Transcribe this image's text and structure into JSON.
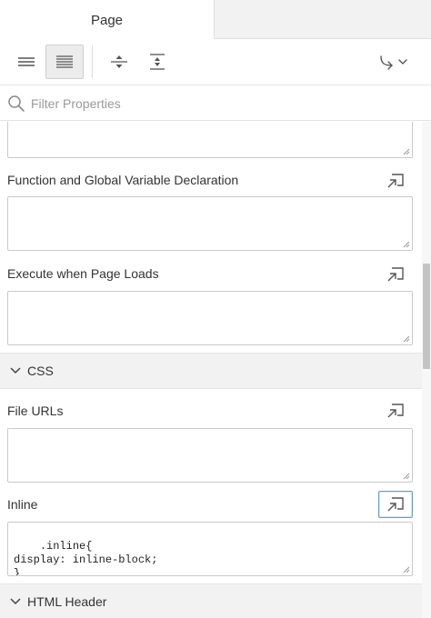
{
  "tabs": [
    {
      "label": "Page"
    },
    {
      "label": ""
    }
  ],
  "toolbar": {
    "buttons": [
      {
        "icon": "list-compact-icon",
        "active": false
      },
      {
        "icon": "list-expanded-icon",
        "active": true
      },
      {
        "icon": "collapse-all-icon",
        "active": false
      },
      {
        "icon": "expand-all-icon",
        "active": false
      },
      {
        "icon": "go-to-group-icon",
        "active": false
      }
    ]
  },
  "filter": {
    "placeholder": "Filter Properties",
    "value": ""
  },
  "properties": {
    "fn_decl": {
      "label": "Function and Global Variable Declaration",
      "value": ""
    },
    "page_load": {
      "label": "Execute when Page Loads",
      "value": ""
    },
    "css_section": {
      "title": "CSS"
    },
    "file_urls": {
      "label": "File URLs",
      "value": ""
    },
    "inline": {
      "label": "Inline",
      "value": ".inline{\ndisplay: inline-block;\n}"
    },
    "html_header_section": {
      "title": "HTML Header"
    }
  },
  "colors": {
    "accent": "#6b9bc8",
    "section_bg": "#f2f2f2"
  }
}
